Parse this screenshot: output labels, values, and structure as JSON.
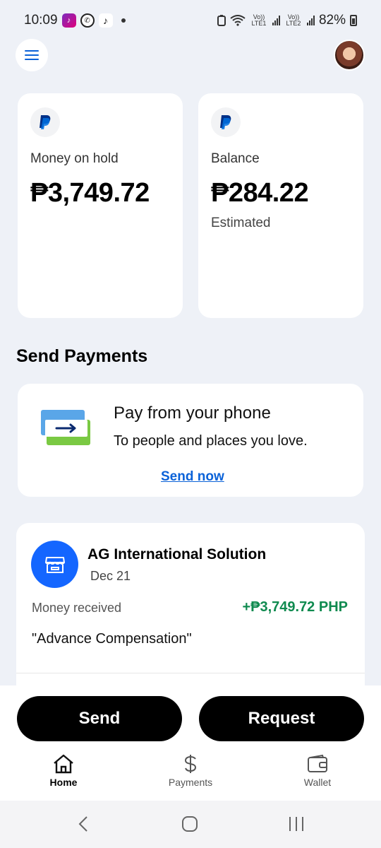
{
  "status_bar": {
    "time": "10:09",
    "battery": "82%",
    "sim1": "Vo)) LTE1",
    "sim2": "Vo)) LTE2"
  },
  "balances": {
    "hold": {
      "label": "Money on hold",
      "amount": "₱3,749.72"
    },
    "balance": {
      "label": "Balance",
      "amount": "₱284.22",
      "sub": "Estimated"
    }
  },
  "send_payments": {
    "title": "Send Payments",
    "card_title": "Pay from your phone",
    "card_subtitle": "To people and places you love.",
    "link": "Send now"
  },
  "transaction": {
    "merchant": "AG International Solution",
    "date": "Dec 21",
    "type": "Money received",
    "amount": "+₱3,749.72 PHP",
    "note": "\"Advance Compensation\""
  },
  "actions": {
    "send": "Send",
    "request": "Request"
  },
  "nav": {
    "home": "Home",
    "payments": "Payments",
    "wallet": "Wallet"
  },
  "colors": {
    "background": "#eef1f7",
    "accent_blue": "#0b62d8",
    "merchant_blue": "#1466ff",
    "positive_green": "#0f8a4f",
    "button_black": "#000000"
  },
  "icons": [
    "menu-icon",
    "paypal-icon",
    "store-icon",
    "home-icon",
    "dollar-icon",
    "wallet-icon",
    "back-icon",
    "home-circle-icon",
    "recents-icon"
  ]
}
